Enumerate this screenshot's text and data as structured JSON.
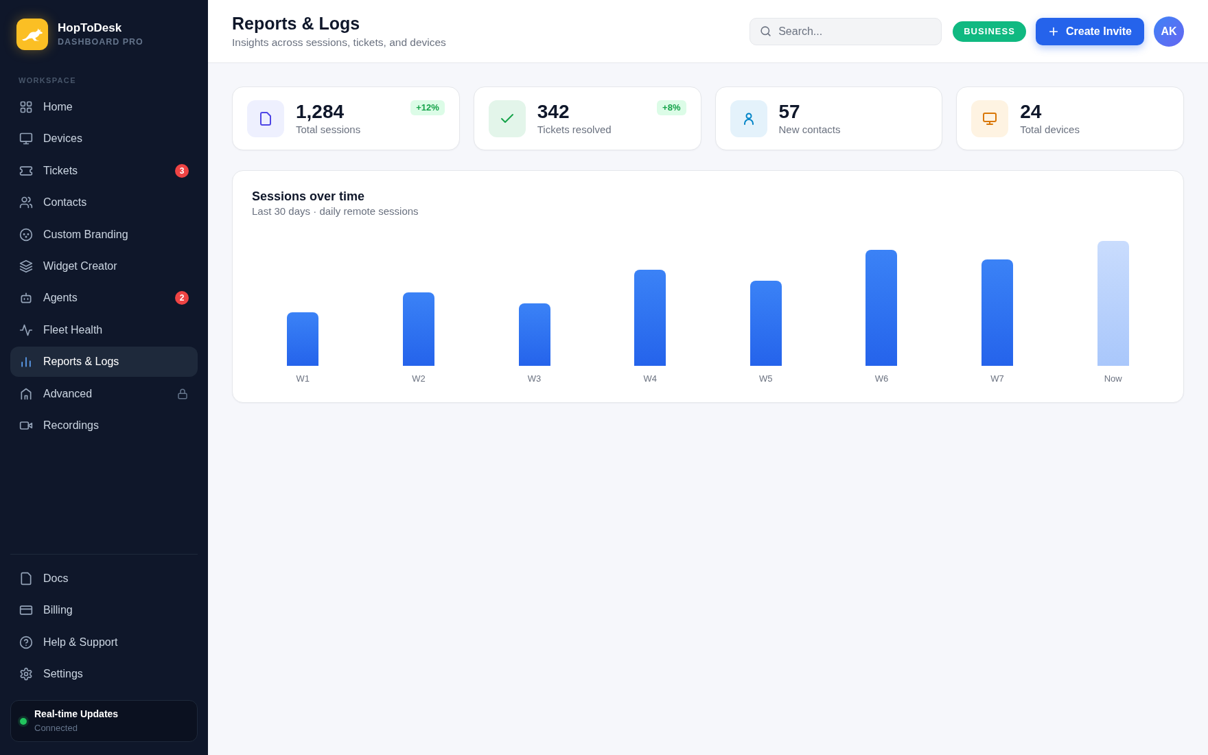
{
  "sidebar": {
    "brand": {
      "name": "HopToDesk",
      "subtitle": "DASHBOARD PRO"
    },
    "section_label": "WORKSPACE",
    "items": [
      {
        "label": "Home",
        "selected": false,
        "locked": false
      },
      {
        "label": "Devices",
        "selected": false,
        "locked": false
      },
      {
        "label": "Tickets",
        "selected": false,
        "locked": false,
        "badge": "3"
      },
      {
        "label": "Contacts",
        "selected": false,
        "locked": false
      },
      {
        "label": "Custom Branding",
        "selected": false,
        "locked": false
      },
      {
        "label": "Widget Creator",
        "selected": false,
        "locked": false
      },
      {
        "label": "Agents",
        "selected": false,
        "locked": false,
        "badge": "2"
      },
      {
        "label": "Fleet Health",
        "selected": false,
        "locked": false
      },
      {
        "label": "Reports & Logs",
        "selected": true,
        "locked": false
      },
      {
        "label": "Advanced",
        "selected": false,
        "locked": true
      },
      {
        "label": "Recordings",
        "selected": false,
        "locked": false
      }
    ],
    "footer_items": [
      {
        "label": "Docs",
        "selected": false
      },
      {
        "label": "Billing",
        "selected": false
      },
      {
        "label": "Help & Support",
        "selected": false
      },
      {
        "label": "Settings",
        "selected": false
      }
    ],
    "status": {
      "title": "Real-time Updates",
      "text": "Connected",
      "connected": true
    }
  },
  "header": {
    "title": "Reports & Logs",
    "subtitle": "Insights across sessions, tickets, and devices",
    "search": {
      "placeholder": "Search..."
    },
    "plan_badge": "BUSINESS",
    "primary_button": "Create Invite",
    "avatar": "AK"
  },
  "stats": [
    {
      "value": "1,284",
      "label": "Total sessions",
      "delta": "+12%"
    },
    {
      "value": "342",
      "label": "Tickets resolved",
      "delta": "+8%"
    },
    {
      "value": "57",
      "label": "New contacts"
    },
    {
      "value": "24",
      "label": "Total devices"
    }
  ],
  "chart": {
    "title": "Sessions over time",
    "subtitle": "Last 30 days · daily remote sessions",
    "bars": [
      {
        "label": "W1",
        "level": 0.43,
        "current": false
      },
      {
        "label": "W2",
        "level": 0.59,
        "current": false
      },
      {
        "label": "W3",
        "level": 0.5,
        "current": false
      },
      {
        "label": "W4",
        "level": 0.77,
        "current": false
      },
      {
        "label": "W5",
        "level": 0.68,
        "current": false
      },
      {
        "label": "W6",
        "level": 0.93,
        "current": false
      },
      {
        "label": "W7",
        "level": 0.85,
        "current": false
      },
      {
        "label": "Now",
        "level": 1,
        "current": true
      }
    ]
  }
}
